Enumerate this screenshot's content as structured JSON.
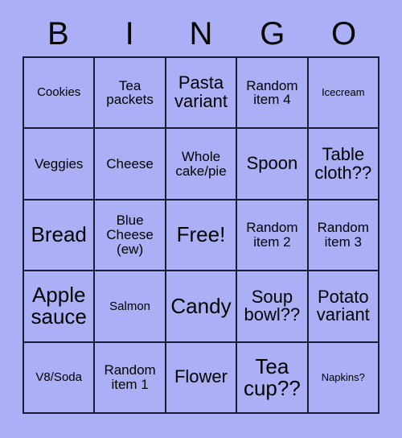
{
  "card": {
    "title": "BINGO",
    "background_color": "#abaff5",
    "border_color": "#1b1b38",
    "text_color": "#000000",
    "header_letters": [
      "B",
      "I",
      "N",
      "G",
      "O"
    ],
    "rows": 5,
    "columns": 5,
    "cells": [
      [
        {
          "text": "Cookies",
          "size": "s",
          "marked": false
        },
        {
          "text": "Tea\npackets",
          "size": "m",
          "marked": false
        },
        {
          "text": "Pasta\nvariant",
          "size": "xl",
          "marked": false
        },
        {
          "text": "Random\nitem 4",
          "size": "m",
          "marked": false
        },
        {
          "text": "Icecream",
          "size": "xs",
          "marked": false
        }
      ],
      [
        {
          "text": "Veggies",
          "size": "m",
          "marked": false
        },
        {
          "text": "Cheese",
          "size": "m",
          "marked": false
        },
        {
          "text": "Whole\ncake/pie",
          "size": "m",
          "marked": false
        },
        {
          "text": "Spoon",
          "size": "xl",
          "marked": false
        },
        {
          "text": "Table\ncloth??",
          "size": "xl",
          "marked": false
        }
      ],
      [
        {
          "text": "Bread",
          "size": "xxl",
          "marked": false
        },
        {
          "text": "Blue\nCheese\n(ew)",
          "size": "m",
          "marked": false
        },
        {
          "text": "Free!",
          "size": "xxl",
          "marked": false
        },
        {
          "text": "Random\nitem 2",
          "size": "m",
          "marked": false
        },
        {
          "text": "Random\nitem 3",
          "size": "m",
          "marked": false
        }
      ],
      [
        {
          "text": "Apple\nsauce",
          "size": "xxl",
          "marked": false
        },
        {
          "text": "Salmon",
          "size": "s",
          "marked": false
        },
        {
          "text": "Candy",
          "size": "xxl",
          "marked": false
        },
        {
          "text": "Soup\nbowl??",
          "size": "xl",
          "marked": false
        },
        {
          "text": "Potato\nvariant",
          "size": "xl",
          "marked": false
        }
      ],
      [
        {
          "text": "V8/Soda",
          "size": "s",
          "marked": false
        },
        {
          "text": "Random\nitem 1",
          "size": "m",
          "marked": false
        },
        {
          "text": "Flower",
          "size": "xl",
          "marked": false
        },
        {
          "text": "Tea\ncup??",
          "size": "xxl",
          "marked": false
        },
        {
          "text": "Napkins?",
          "size": "xs",
          "marked": false
        }
      ]
    ]
  }
}
